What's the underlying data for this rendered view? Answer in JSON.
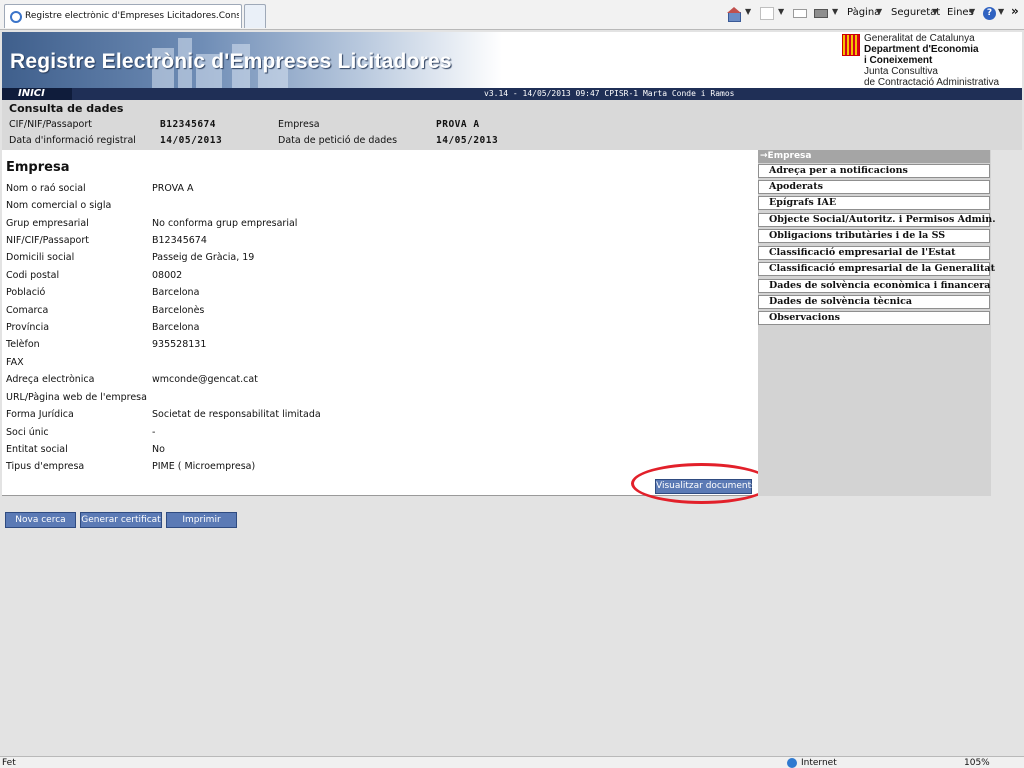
{
  "browser": {
    "tab_title": "Registre electrònic d'Empreses Licitadores.Consulta A...",
    "commands": {
      "page": "Pàgina",
      "security": "Seguretat",
      "tools": "Eines"
    },
    "status_left": "Fet",
    "status_zone": "Internet",
    "zoom": "105%"
  },
  "banner": {
    "title": "Registre Electrònic d'Empreses Licitadores",
    "org_line1": "Generalitat de Catalunya",
    "org_line2": "Department d'Economia",
    "org_line3": "i Coneixement",
    "org_line4": "Junta Consultiva",
    "org_line5": "de Contractació Administrativa"
  },
  "nav": {
    "inici": "INICI",
    "version": "v3.14 - 14/05/2013 09:47 CPISR-1 Marta Conde i Ramos"
  },
  "consulta": {
    "title": "Consulta de dades",
    "cif_label": "CIF/NIF/Passaport",
    "cif_value": "B12345674",
    "empresa_label": "Empresa",
    "empresa_value": "PROVA A",
    "data_info_label": "Data d'informació registral",
    "data_info_value": "14/05/2013",
    "data_peticio_label": "Data de petició de dades",
    "data_peticio_value": "14/05/2013"
  },
  "main": {
    "title": "Empresa",
    "rows": [
      {
        "label": "Nom o raó social",
        "value": "PROVA A"
      },
      {
        "label": "Nom comercial o sigla",
        "value": ""
      },
      {
        "label": "Grup empresarial",
        "value": "No conforma grup empresarial"
      },
      {
        "label": "NIF/CIF/Passaport",
        "value": "B12345674"
      },
      {
        "label": "Domicili social",
        "value": "Passeig de Gràcia, 19"
      },
      {
        "label": "Codi postal",
        "value": "08002"
      },
      {
        "label": "Població",
        "value": "Barcelona"
      },
      {
        "label": "Comarca",
        "value": "Barcelonès"
      },
      {
        "label": "Província",
        "value": "Barcelona"
      },
      {
        "label": "Telèfon",
        "value": "935528131"
      },
      {
        "label": "FAX",
        "value": ""
      },
      {
        "label": "Adreça electrònica",
        "value": "wmconde@gencat.cat"
      },
      {
        "label": "URL/Pàgina web de l'empresa",
        "value": ""
      },
      {
        "label": "Forma Jurídica",
        "value": "Societat de responsabilitat limitada"
      },
      {
        "label": "Soci únic",
        "value": "-"
      },
      {
        "label": "Entitat social",
        "value": "No"
      },
      {
        "label": "Tipus d'empresa",
        "value": "PIME ( Microempresa)"
      }
    ],
    "docs_button": "Visualitzar documents"
  },
  "side_menu": {
    "active": "→Empresa",
    "items": [
      "Adreça per a notificacions",
      "Apoderats",
      "Epígrafs IAE",
      "Objecte Social/Autoritz. i Permisos Admin.",
      "Obligacions tributàries i de la SS",
      "Classificació empresarial de l'Estat",
      "Classificació empresarial de la Generalitat",
      "Dades de solvència econòmica i financera",
      "Dades de solvència tècnica",
      "Observacions"
    ]
  },
  "buttons": {
    "new_search": "Nova cerca",
    "generate_cert": "Generar certificat",
    "print": "Imprimir"
  }
}
